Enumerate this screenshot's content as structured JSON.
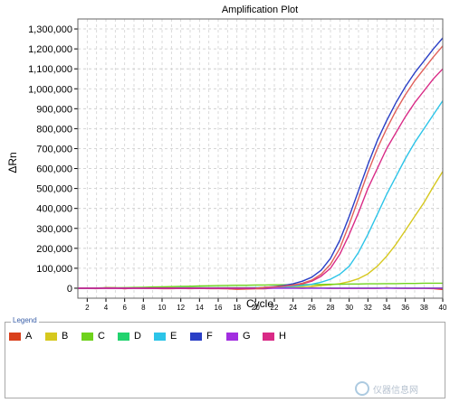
{
  "chart_data": {
    "type": "line",
    "title": "Amplification Plot",
    "xlabel": "Cycle",
    "ylabel": "ΔRn",
    "xlim": [
      1,
      40
    ],
    "ylim": [
      -50000,
      1350000
    ],
    "x_ticks": [
      2,
      4,
      6,
      8,
      10,
      12,
      14,
      16,
      18,
      20,
      22,
      24,
      26,
      28,
      30,
      32,
      34,
      36,
      38,
      40
    ],
    "y_ticks": [
      0,
      100000,
      200000,
      300000,
      400000,
      500000,
      600000,
      700000,
      800000,
      900000,
      1000000,
      1100000,
      1200000,
      1300000
    ],
    "y_tick_labels": [
      "0",
      "100,000",
      "200,000",
      "300,000",
      "400,000",
      "500,000",
      "600,000",
      "700,000",
      "800,000",
      "900,000",
      "1,000,000",
      "1,100,000",
      "1,200,000",
      "1,300,000"
    ],
    "grid": true,
    "legend_title": "Legend",
    "series": [
      {
        "name": "A",
        "color": "#d9401c",
        "x": [
          1,
          2,
          3,
          4,
          5,
          6,
          7,
          8,
          9,
          10,
          11,
          12,
          13,
          14,
          15,
          16,
          17,
          18,
          19,
          20,
          21,
          22,
          23,
          24,
          25,
          26,
          27,
          28,
          29,
          30,
          31,
          32,
          33,
          34,
          35,
          36,
          37,
          38,
          39,
          40
        ],
        "y": [
          0,
          0,
          -2000,
          3000,
          2000,
          -3000,
          1000,
          0,
          -1000,
          -2000,
          -2000,
          -1000,
          -2000,
          -1000,
          -2000,
          -2000,
          -3000,
          -5000,
          -4000,
          -3000,
          -3000,
          1000,
          2000,
          1000,
          0,
          2000,
          1000,
          -1000,
          -1000,
          -1000,
          -1000,
          -1000,
          -1000,
          2000,
          0,
          -1000,
          -1000,
          -1000,
          -2000,
          -6000
        ]
      },
      {
        "name": "B",
        "color": "#d6c81e",
        "x": [
          1,
          2,
          3,
          4,
          5,
          6,
          7,
          8,
          9,
          10,
          11,
          12,
          13,
          14,
          15,
          16,
          17,
          18,
          19,
          20,
          21,
          22,
          23,
          24,
          25,
          26,
          27,
          28,
          29,
          30,
          31,
          32,
          33,
          34,
          35,
          36,
          37,
          38,
          39,
          40
        ],
        "y": [
          0,
          0,
          0,
          1000,
          1000,
          1000,
          1000,
          2000,
          2000,
          2000,
          2000,
          2000,
          3000,
          3000,
          3000,
          3000,
          3000,
          3000,
          3000,
          3000,
          4000,
          5000,
          6000,
          7000,
          8000,
          10000,
          13000,
          17000,
          23000,
          33000,
          48000,
          72000,
          110000,
          160000,
          220000,
          290000,
          360000,
          430000,
          510000,
          585000
        ]
      },
      {
        "name": "C",
        "color": "#6fd21c",
        "x": [
          1,
          2,
          3,
          4,
          5,
          6,
          7,
          8,
          9,
          10,
          11,
          12,
          13,
          14,
          15,
          16,
          17,
          18,
          19,
          20,
          21,
          22,
          23,
          24,
          25,
          26,
          27,
          28,
          29,
          30,
          31,
          32,
          33,
          34,
          35,
          36,
          37,
          38,
          39,
          40
        ],
        "y": [
          0,
          0,
          1000,
          2000,
          2000,
          3000,
          4000,
          5000,
          6000,
          7000,
          8000,
          9000,
          10000,
          11000,
          12000,
          13000,
          14000,
          15000,
          15000,
          16000,
          16000,
          17000,
          17000,
          18000,
          18000,
          19000,
          19000,
          20000,
          20000,
          21000,
          21000,
          22000,
          22000,
          23000,
          23000,
          24000,
          24000,
          25000,
          25000,
          25000
        ]
      },
      {
        "name": "D",
        "color": "#22d36e",
        "x": [
          1,
          2,
          3,
          4,
          5,
          6,
          7,
          8,
          9,
          10,
          11,
          12,
          13,
          14,
          15,
          16,
          17,
          18,
          19,
          20,
          21,
          22,
          23,
          24,
          25,
          26,
          27,
          28,
          29,
          30,
          31,
          32,
          33,
          34,
          35,
          36,
          37,
          38,
          39,
          40
        ],
        "y": [
          0,
          0,
          0,
          1000,
          1000,
          1000,
          1000,
          1000,
          1000,
          1000,
          1000,
          1000,
          1000,
          1000,
          1000,
          1000,
          1000,
          1000,
          1000,
          1000,
          1000,
          1000,
          1000,
          1000,
          1000,
          1000,
          1000,
          1000,
          1000,
          1000,
          1000,
          1000,
          1000,
          1000,
          1000,
          1000,
          1000,
          1000,
          1000,
          1000
        ]
      },
      {
        "name": "E",
        "color": "#2cc4e8",
        "x": [
          1,
          2,
          3,
          4,
          5,
          6,
          7,
          8,
          9,
          10,
          11,
          12,
          13,
          14,
          15,
          16,
          17,
          18,
          19,
          20,
          21,
          22,
          23,
          24,
          25,
          26,
          27,
          28,
          29,
          30,
          31,
          32,
          33,
          34,
          35,
          36,
          37,
          38,
          39,
          40
        ],
        "y": [
          0,
          0,
          0,
          1000,
          1000,
          1000,
          1000,
          1000,
          1000,
          1000,
          1000,
          2000,
          2000,
          2000,
          2000,
          2000,
          2000,
          2000,
          2000,
          3000,
          4000,
          5000,
          7000,
          10000,
          14000,
          20000,
          30000,
          45000,
          70000,
          110000,
          180000,
          270000,
          370000,
          470000,
          560000,
          650000,
          730000,
          800000,
          870000,
          940000
        ]
      },
      {
        "name": "F",
        "color": "#2a3fc6",
        "x": [
          1,
          2,
          3,
          4,
          5,
          6,
          7,
          8,
          9,
          10,
          11,
          12,
          13,
          14,
          15,
          16,
          17,
          18,
          19,
          20,
          21,
          22,
          23,
          24,
          25,
          26,
          27,
          28,
          29,
          30,
          31,
          32,
          33,
          34,
          35,
          36,
          37,
          38,
          39,
          40
        ],
        "y": [
          0,
          0,
          0,
          0,
          0,
          0,
          0,
          0,
          0,
          0,
          0,
          0,
          0,
          0,
          0,
          0,
          0,
          0,
          0,
          0,
          5000,
          8000,
          14000,
          22000,
          35000,
          55000,
          90000,
          150000,
          240000,
          360000,
          490000,
          620000,
          740000,
          840000,
          930000,
          1010000,
          1080000,
          1140000,
          1200000,
          1255000
        ]
      },
      {
        "name": "G",
        "color": "#a22ee0",
        "x": [
          1,
          2,
          3,
          4,
          5,
          6,
          7,
          8,
          9,
          10,
          11,
          12,
          13,
          14,
          15,
          16,
          17,
          18,
          19,
          20,
          21,
          22,
          23,
          24,
          25,
          26,
          27,
          28,
          29,
          30,
          31,
          32,
          33,
          34,
          35,
          36,
          37,
          38,
          39,
          40
        ],
        "y": [
          0,
          0,
          0,
          0,
          0,
          0,
          0,
          0,
          0,
          0,
          0,
          0,
          0,
          0,
          0,
          0,
          0,
          0,
          0,
          0,
          0,
          0,
          0,
          0,
          0,
          0,
          0,
          0,
          0,
          0,
          0,
          0,
          0,
          0,
          0,
          0,
          0,
          0,
          0,
          0
        ]
      },
      {
        "name": "H",
        "color": "#d92a86",
        "x": [
          1,
          2,
          3,
          4,
          5,
          6,
          7,
          8,
          9,
          10,
          11,
          12,
          13,
          14,
          15,
          16,
          17,
          18,
          19,
          20,
          21,
          22,
          23,
          24,
          25,
          26,
          27,
          28,
          29,
          30,
          31,
          32,
          33,
          34,
          35,
          36,
          37,
          38,
          39,
          40
        ],
        "y": [
          0,
          0,
          0,
          0,
          0,
          0,
          0,
          0,
          0,
          0,
          0,
          0,
          0,
          0,
          0,
          0,
          0,
          0,
          0,
          0,
          4000,
          6000,
          10000,
          15000,
          22000,
          35000,
          60000,
          100000,
          170000,
          270000,
          380000,
          500000,
          600000,
          700000,
          780000,
          860000,
          930000,
          990000,
          1050000,
          1100000
        ]
      }
    ],
    "extra_curves": [
      {
        "color": "#e0605a",
        "x": [
          20,
          21,
          22,
          23,
          24,
          25,
          26,
          27,
          28,
          29,
          30,
          31,
          32,
          33,
          34,
          35,
          36,
          37,
          38,
          39,
          40
        ],
        "y": [
          0,
          4000,
          6000,
          10000,
          16000,
          25000,
          40000,
          70000,
          120000,
          200000,
          320000,
          450000,
          580000,
          700000,
          800000,
          890000,
          970000,
          1040000,
          1100000,
          1160000,
          1215000
        ]
      }
    ]
  },
  "legend": {
    "title": "Legend",
    "items": [
      {
        "label": "A",
        "color": "#d9401c"
      },
      {
        "label": "B",
        "color": "#d6c81e"
      },
      {
        "label": "C",
        "color": "#6fd21c"
      },
      {
        "label": "D",
        "color": "#22d36e"
      },
      {
        "label": "E",
        "color": "#2cc4e8"
      },
      {
        "label": "F",
        "color": "#2a3fc6"
      },
      {
        "label": "G",
        "color": "#a22ee0"
      },
      {
        "label": "H",
        "color": "#d92a86"
      }
    ]
  },
  "watermark": {
    "icon": "instrument-logo-icon",
    "text": "仪器信息网"
  }
}
